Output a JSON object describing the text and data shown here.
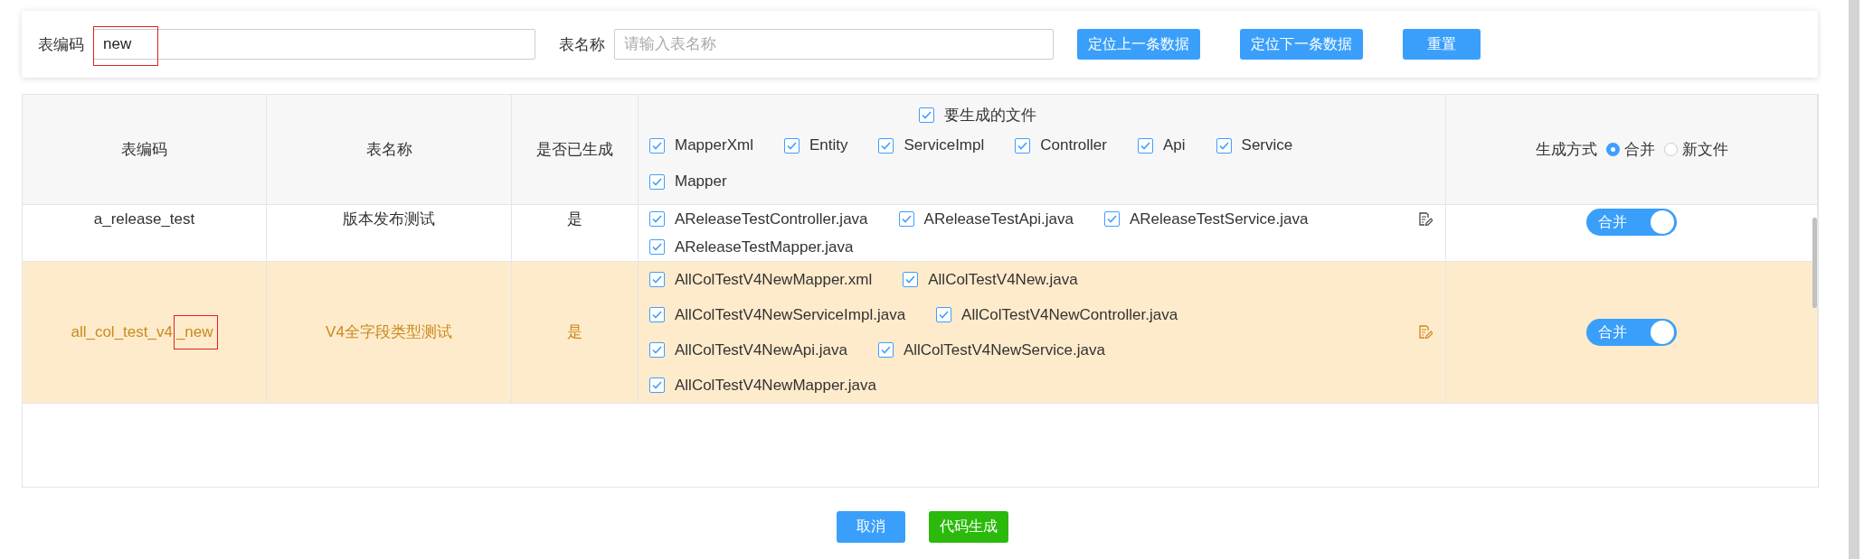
{
  "filter": {
    "fields": [
      {
        "label": "表编码",
        "value": "new",
        "highlighted": true
      },
      {
        "label": "表名称",
        "placeholder": "请输入表名称"
      }
    ],
    "buttons": [
      "定位上一条数据",
      "定位下一条数据",
      "重置"
    ]
  },
  "table": {
    "columns": [
      {
        "kind": "text",
        "label": "表编码"
      },
      {
        "kind": "text",
        "label": "表名称"
      },
      {
        "kind": "text",
        "label": "是否已生成"
      },
      {
        "kind": "files",
        "label": "要生成的文件",
        "checked": true,
        "options": [
          {
            "label": "MapperXml",
            "checked": true
          },
          {
            "label": "Entity",
            "checked": true
          },
          {
            "label": "ServiceImpl",
            "checked": true
          },
          {
            "label": "Controller",
            "checked": true
          },
          {
            "label": "Api",
            "checked": true
          },
          {
            "label": "Service",
            "checked": true
          },
          {
            "label": "Mapper",
            "checked": true
          }
        ]
      },
      {
        "kind": "mode",
        "label": "生成方式",
        "options": [
          {
            "label": "合并",
            "selected": true
          },
          {
            "label": "新文件",
            "selected": false
          }
        ]
      }
    ],
    "rows": [
      {
        "selected": false,
        "code": "a_release_test",
        "code_match": "",
        "name": "版本发布测试",
        "generated": "是",
        "files": [
          {
            "name": "AReleaseTestController.java",
            "checked": true
          },
          {
            "name": "AReleaseTestApi.java",
            "checked": true
          },
          {
            "name": "AReleaseTestService.java",
            "checked": true
          },
          {
            "name": "AReleaseTestMapper.java",
            "checked": true
          }
        ],
        "merge": {
          "label": "合并",
          "on": true
        }
      },
      {
        "selected": true,
        "code": "all_col_test_v4",
        "code_match": "_new",
        "name": "V4全字段类型测试",
        "generated": "是",
        "files": [
          {
            "name": "AllColTestV4NewMapper.xml",
            "checked": true
          },
          {
            "name": "AllColTestV4New.java",
            "checked": true
          },
          {
            "name": "AllColTestV4NewServiceImpl.java",
            "checked": true
          },
          {
            "name": "AllColTestV4NewController.java",
            "checked": true
          },
          {
            "name": "AllColTestV4NewApi.java",
            "checked": true
          },
          {
            "name": "AllColTestV4NewService.java",
            "checked": true
          },
          {
            "name": "AllColTestV4NewMapper.java",
            "checked": true
          }
        ],
        "merge": {
          "label": "合并",
          "on": true
        }
      }
    ]
  },
  "footer": {
    "buttons": [
      {
        "label": "取消",
        "kind": "cancel"
      },
      {
        "label": "代码生成",
        "kind": "primary"
      }
    ]
  }
}
